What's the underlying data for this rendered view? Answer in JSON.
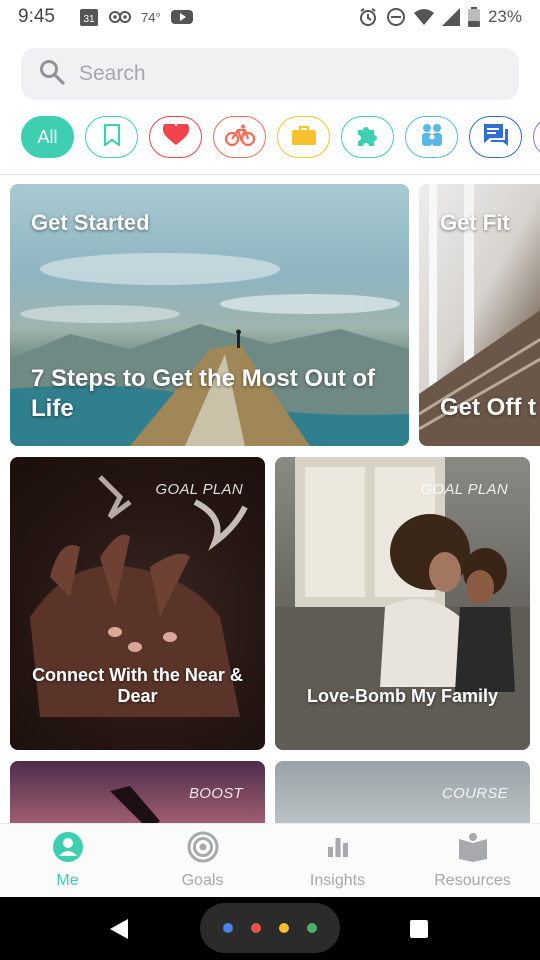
{
  "status_bar": {
    "time": "9:45",
    "calendar_day": "31",
    "temperature": "74°",
    "battery": "23%"
  },
  "search": {
    "placeholder": "Search"
  },
  "chips": [
    {
      "label": "All",
      "icon": "all",
      "color": "#3ecfb0",
      "selected": true
    },
    {
      "label": "",
      "icon": "bookmark-icon",
      "color": "#3ecfb0"
    },
    {
      "label": "",
      "icon": "heart-icon",
      "color": "#f0434b"
    },
    {
      "label": "",
      "icon": "bicycle-icon",
      "color": "#f26e52"
    },
    {
      "label": "",
      "icon": "briefcase-icon",
      "color": "#f6c32e"
    },
    {
      "label": "",
      "icon": "puzzle-icon",
      "color": "#3ecfb0"
    },
    {
      "label": "",
      "icon": "family-icon",
      "color": "#5ab8e8"
    },
    {
      "label": "",
      "icon": "chat-icon",
      "color": "#2f6ed3"
    },
    {
      "label": "",
      "icon": "more-icon",
      "color": "#a46adf"
    }
  ],
  "featured": [
    {
      "category": "Get Started",
      "title": "7 Steps to Get the Most Out of Life"
    },
    {
      "category": "Get Fit",
      "title": "Get Off t"
    }
  ],
  "grid": [
    {
      "tag": "GOAL PLAN",
      "title": "Connect With the Near & Dear"
    },
    {
      "tag": "GOAL PLAN",
      "title": "Love-Bomb My Family"
    },
    {
      "tag": "BOOST",
      "title": ""
    },
    {
      "tag": "COURSE",
      "title": ""
    }
  ],
  "bottom_nav": [
    {
      "label": "Me",
      "icon": "person-icon",
      "active": true
    },
    {
      "label": "Goals",
      "icon": "target-icon",
      "active": false
    },
    {
      "label": "Insights",
      "icon": "bar-chart-icon",
      "active": false
    },
    {
      "label": "Resources",
      "icon": "book-icon",
      "active": false
    }
  ],
  "colors": {
    "accent": "#3ecfb0",
    "inactive": "#a7a9ad"
  }
}
